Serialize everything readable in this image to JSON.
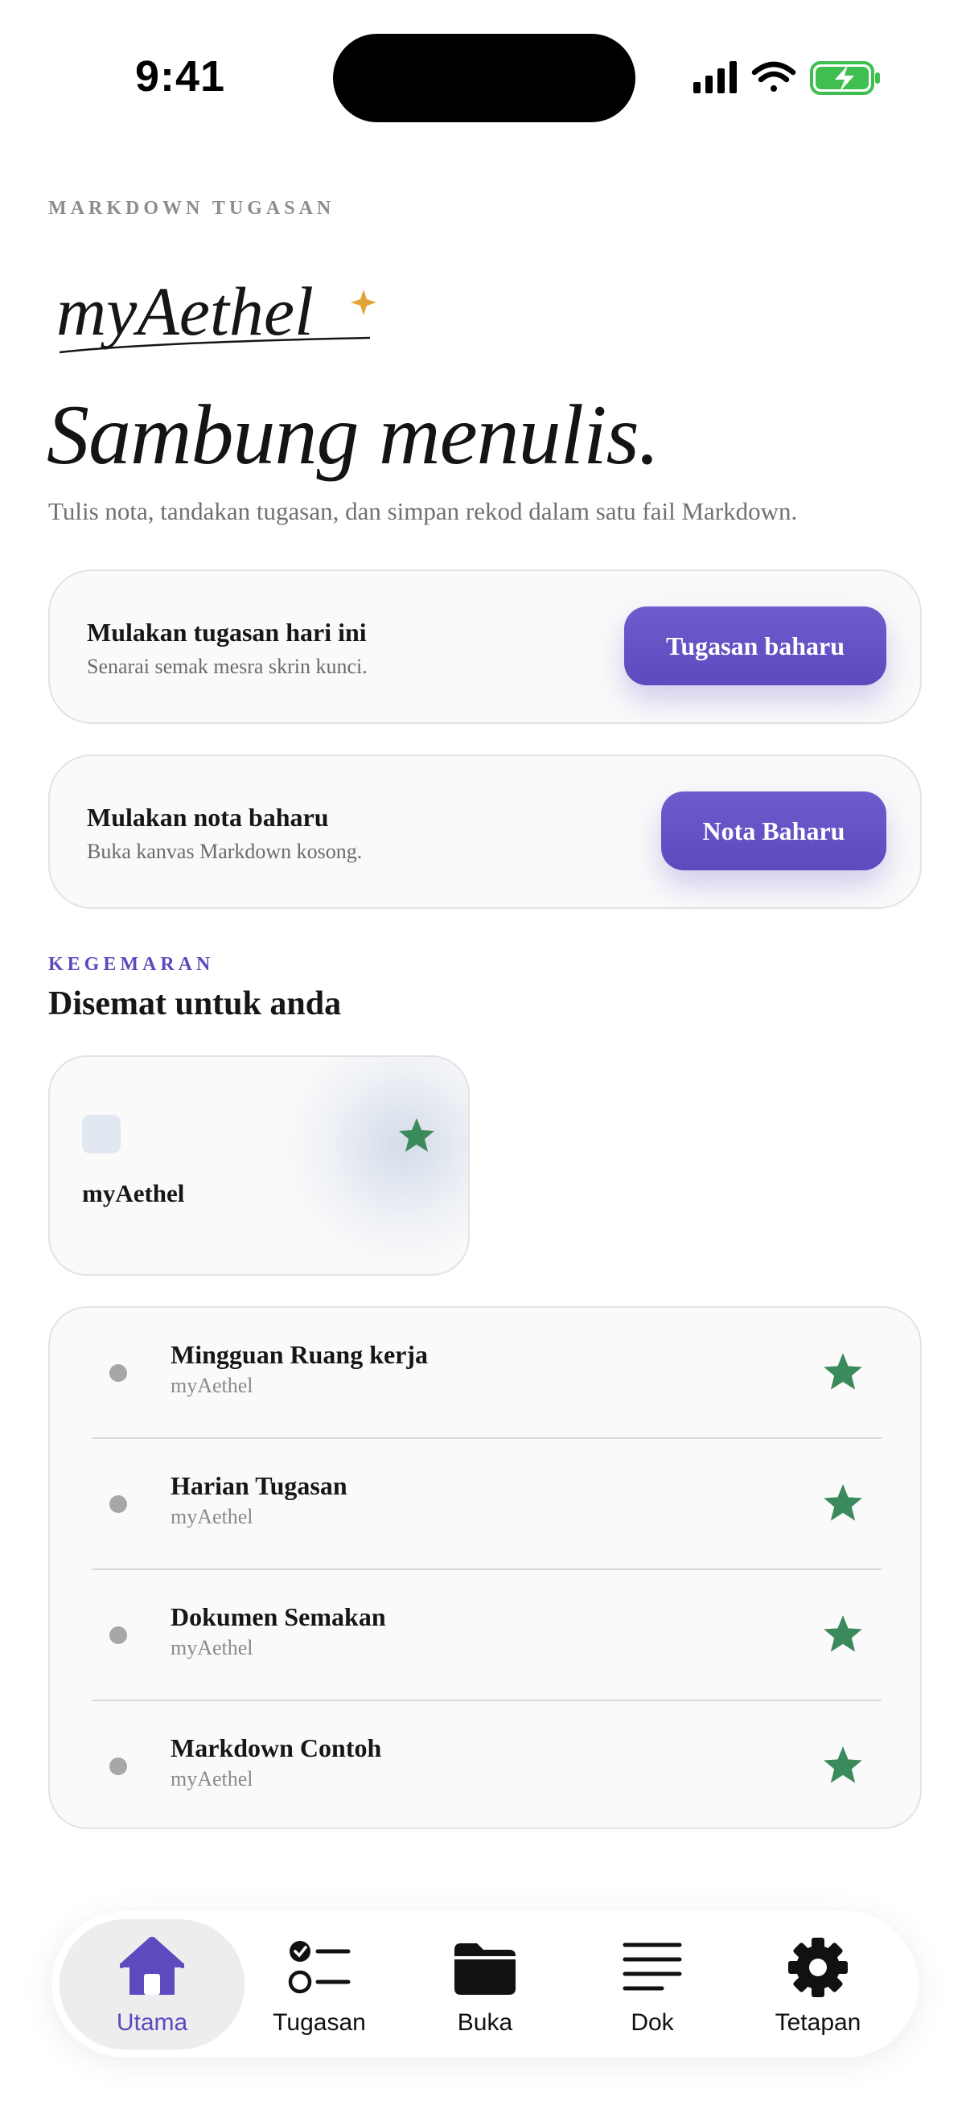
{
  "status": {
    "time": "9:41"
  },
  "header": {
    "eyebrow": "MARKDOWN TUGASAN",
    "brand": "myAethel",
    "headline": "Sambung menulis.",
    "subline": "Tulis nota, tandakan tugasan, dan simpan rekod dalam satu fail Markdown."
  },
  "actions": [
    {
      "title": "Mulakan tugasan hari ini",
      "desc": "Senarai semak mesra skrin kunci.",
      "button": "Tugasan baharu"
    },
    {
      "title": "Mulakan nota baharu",
      "desc": "Buka kanvas Markdown kosong.",
      "button": "Nota Baharu"
    }
  ],
  "favorites": {
    "eyebrow": "KEGEMARAN",
    "title": "Disemat untuk anda",
    "pinned": {
      "name": "myAethel",
      "icon": "star-icon"
    }
  },
  "documents": [
    {
      "title": "Mingguan Ruang kerja",
      "workspace": "myAethel"
    },
    {
      "title": "Harian Tugasan",
      "workspace": "myAethel"
    },
    {
      "title": "Dokumen Semakan",
      "workspace": "myAethel"
    },
    {
      "title": "Markdown Contoh",
      "workspace": "myAethel"
    }
  ],
  "tabs": [
    {
      "label": "Utama",
      "icon": "home-icon",
      "active": true
    },
    {
      "label": "Tugasan",
      "icon": "tasks-icon",
      "active": false
    },
    {
      "label": "Buka",
      "icon": "folder-icon",
      "active": false
    },
    {
      "label": "Dok",
      "icon": "document-lines-icon",
      "active": false
    },
    {
      "label": "Tetapan",
      "icon": "gear-icon",
      "active": false
    }
  ],
  "colors": {
    "accent": "#5b4bbf",
    "star": "#3b8a5c",
    "battery": "#3fbf4f"
  }
}
